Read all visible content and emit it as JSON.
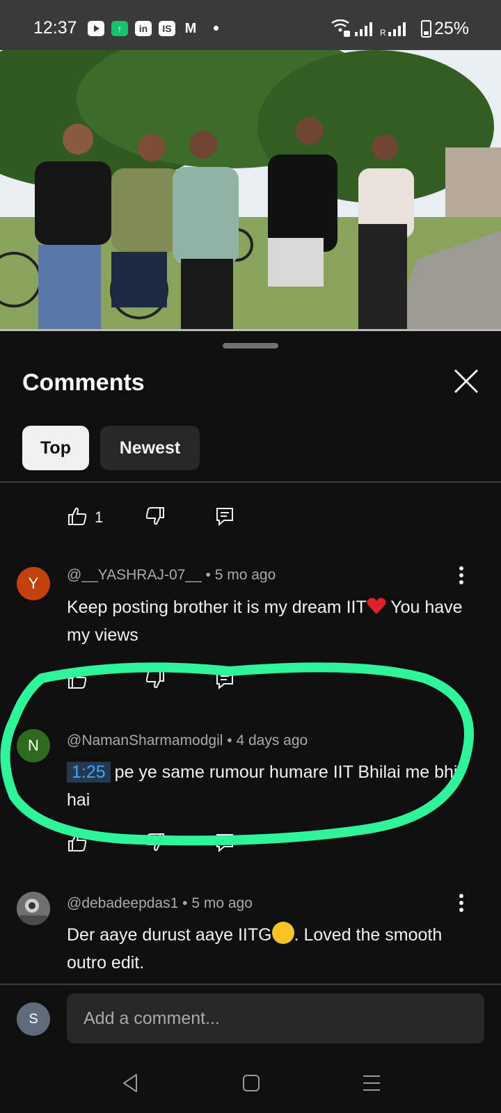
{
  "status_bar": {
    "time": "12:37",
    "battery": "25%",
    "notification_icons": [
      "youtube-icon",
      "upload-icon",
      "linkedin-icon",
      "app-icon",
      "gmail-icon"
    ]
  },
  "sheet": {
    "title": "Comments",
    "chips": [
      {
        "label": "Top",
        "selected": true
      },
      {
        "label": "Newest",
        "selected": false
      }
    ]
  },
  "top_actions": {
    "like_count": "1"
  },
  "comments": [
    {
      "avatar_letter": "Y",
      "avatar_color": "#c2410c",
      "author": "@__YASHRAJ-07__",
      "age": "5 mo ago",
      "text_before": "Keep posting brother it is my dream IIT",
      "text_after": " You have my views"
    },
    {
      "avatar_letter": "N",
      "avatar_color": "#2f6b1f",
      "author": "@NamanSharmamodgil",
      "age": "4 days ago",
      "timestamp": "1:25",
      "text": "pe ye same rumour humare  IIT Bhilai me bhi hai"
    },
    {
      "author": "@debadeepdas1",
      "age": "5 mo ago",
      "text_before": "Der aaye durust aaye IITG",
      "text_after": ". Loved the smooth outro edit."
    }
  ],
  "composer": {
    "avatar_letter": "S",
    "placeholder": "Add a comment..."
  },
  "colors": {
    "background": "#0f0f0f",
    "highlight_stroke": "#2ef59a",
    "timestamp_link": "#3ea6ff"
  }
}
